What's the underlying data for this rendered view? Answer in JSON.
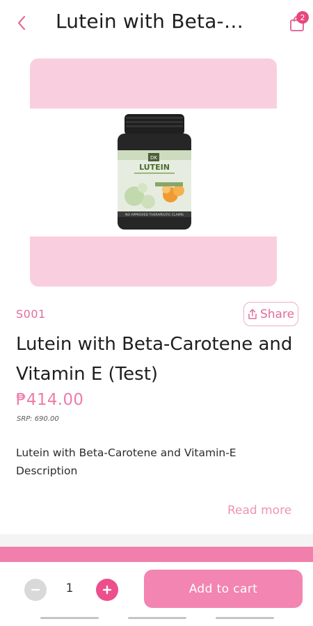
{
  "header": {
    "title": "Lutein with Beta-…",
    "cart_count": "2",
    "back_icon": "chevron-left-icon",
    "cart_icon": "shopping-bag-icon"
  },
  "product": {
    "image_label": "LUTEIN",
    "image_brand": "DK",
    "image_caption": "NO APPROVED THERAPEUTIC CLAIMS",
    "sku": "S001",
    "share_label": "Share",
    "title": "Lutein with Beta-Carotene and Vitamin E (Test)",
    "price": "₱414.00",
    "srp": "SRP: 690.00",
    "description": "Lutein with Beta-Carotene and Vitamin-E Description",
    "read_more": "Read more"
  },
  "cart_controls": {
    "quantity": "1",
    "add_to_cart_label": "Add to cart"
  },
  "colors": {
    "accent": "#ec4f8b",
    "price": "#ee7ca9",
    "image_background": "#f9cfdf",
    "button": "#f285b1"
  }
}
